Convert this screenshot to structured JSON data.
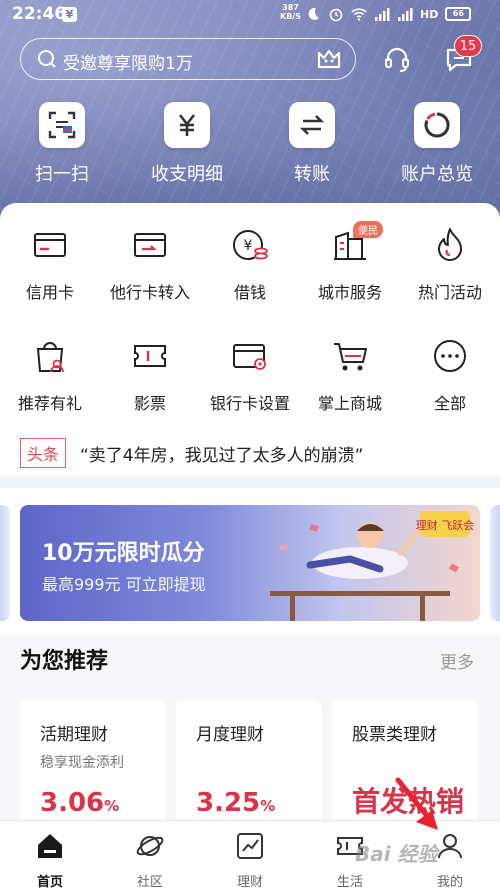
{
  "status": {
    "time": "22:46",
    "net_speed_num": "387",
    "net_speed_unit": "KB/S",
    "battery": "66"
  },
  "header": {
    "search_placeholder": "受邀尊享限购1万",
    "message_count": "15"
  },
  "quick_actions": [
    {
      "label": "扫一扫",
      "icon": "scan-icon"
    },
    {
      "label": "收支明细",
      "icon": "yuan-icon"
    },
    {
      "label": "转账",
      "icon": "transfer-icon"
    },
    {
      "label": "账户总览",
      "icon": "pie-icon"
    }
  ],
  "services_row1": [
    {
      "label": "信用卡",
      "icon": "credit-card-icon"
    },
    {
      "label": "他行卡转入",
      "icon": "card-in-icon"
    },
    {
      "label": "借钱",
      "icon": "loan-icon"
    },
    {
      "label": "城市服务",
      "icon": "city-icon",
      "tag": "便民"
    },
    {
      "label": "热门活动",
      "icon": "flame-icon"
    }
  ],
  "services_row2": [
    {
      "label": "推荐有礼",
      "icon": "gift-bag-icon"
    },
    {
      "label": "影票",
      "icon": "ticket-icon"
    },
    {
      "label": "银行卡设置",
      "icon": "card-settings-icon"
    },
    {
      "label": "掌上商城",
      "icon": "cart-icon"
    },
    {
      "label": "全部",
      "icon": "more-icon"
    }
  ],
  "headline": {
    "tag": "头条",
    "text": "“卖了4年房，我见过了太多人的崩溃”"
  },
  "banner": {
    "title": "10万元限时瓜分",
    "subtitle": "最高999元 可立即提现",
    "badge_text": "理财 飞跃会"
  },
  "recommend": {
    "title": "为您推荐",
    "more": "更多",
    "cards": [
      {
        "title": "活期理财",
        "subtitle": "稳享现金添利",
        "value": "3.06",
        "unit": "%"
      },
      {
        "title": "月度理财",
        "subtitle": "",
        "value": "3.25",
        "unit": "%"
      },
      {
        "title": "股票类理财",
        "subtitle": "",
        "promo": "首发热销"
      }
    ]
  },
  "bottom_nav": [
    {
      "label": "首页",
      "icon": "home-icon",
      "active": true
    },
    {
      "label": "社区",
      "icon": "planet-icon",
      "active": false
    },
    {
      "label": "理财",
      "icon": "chart-icon",
      "active": false
    },
    {
      "label": "生活",
      "icon": "ticket-life-icon",
      "active": false
    },
    {
      "label": "我的",
      "icon": "user-icon",
      "active": false
    }
  ],
  "watermark": "Bai 经验",
  "colors": {
    "accent_red": "#d9344a",
    "hero_blue": "#6f79ae",
    "badge_red": "#e9384c"
  }
}
